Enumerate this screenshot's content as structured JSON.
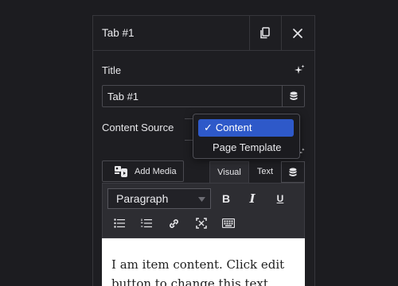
{
  "panel": {
    "title": "Tab #1",
    "duplicate_icon": "duplicate-icon",
    "close_icon": "close-icon"
  },
  "title_field": {
    "label": "Title",
    "value": "Tab #1",
    "ai_icon": "sparkle-icon",
    "dynamic_icon": "database-icon"
  },
  "content_source": {
    "label": "Content Source",
    "options": [
      "Content",
      "Page Template"
    ],
    "selected": "Content"
  },
  "editor": {
    "add_media_label": "Add Media",
    "tab_visual": "Visual",
    "tab_text": "Text",
    "format_select": "Paragraph",
    "bold": "B",
    "italic": "I",
    "underline": "U",
    "content": "I am item content. Click edit button to change this text."
  }
}
